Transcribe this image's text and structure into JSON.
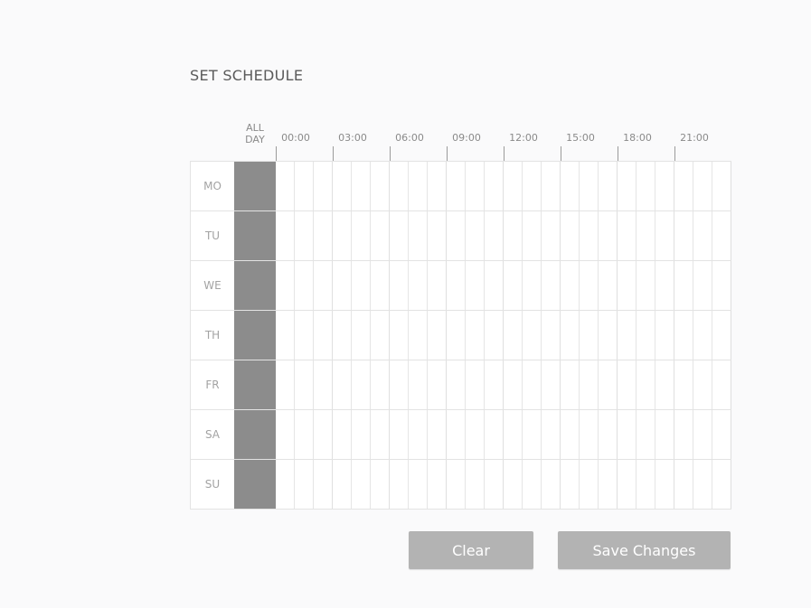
{
  "title": "SET SCHEDULE",
  "header": {
    "all_day": "ALL\nDAY",
    "hours": [
      "00:00",
      "03:00",
      "06:00",
      "09:00",
      "12:00",
      "15:00",
      "18:00",
      "21:00"
    ]
  },
  "schedule": {
    "days": [
      "MO",
      "TU",
      "WE",
      "TH",
      "FR",
      "SA",
      "SU"
    ],
    "hour_columns": 24,
    "all_day_selected": true,
    "colors": {
      "selected": "#8c8c8c",
      "grid": "#e3e3e3"
    }
  },
  "buttons": {
    "clear": "Clear",
    "save": "Save Changes"
  }
}
